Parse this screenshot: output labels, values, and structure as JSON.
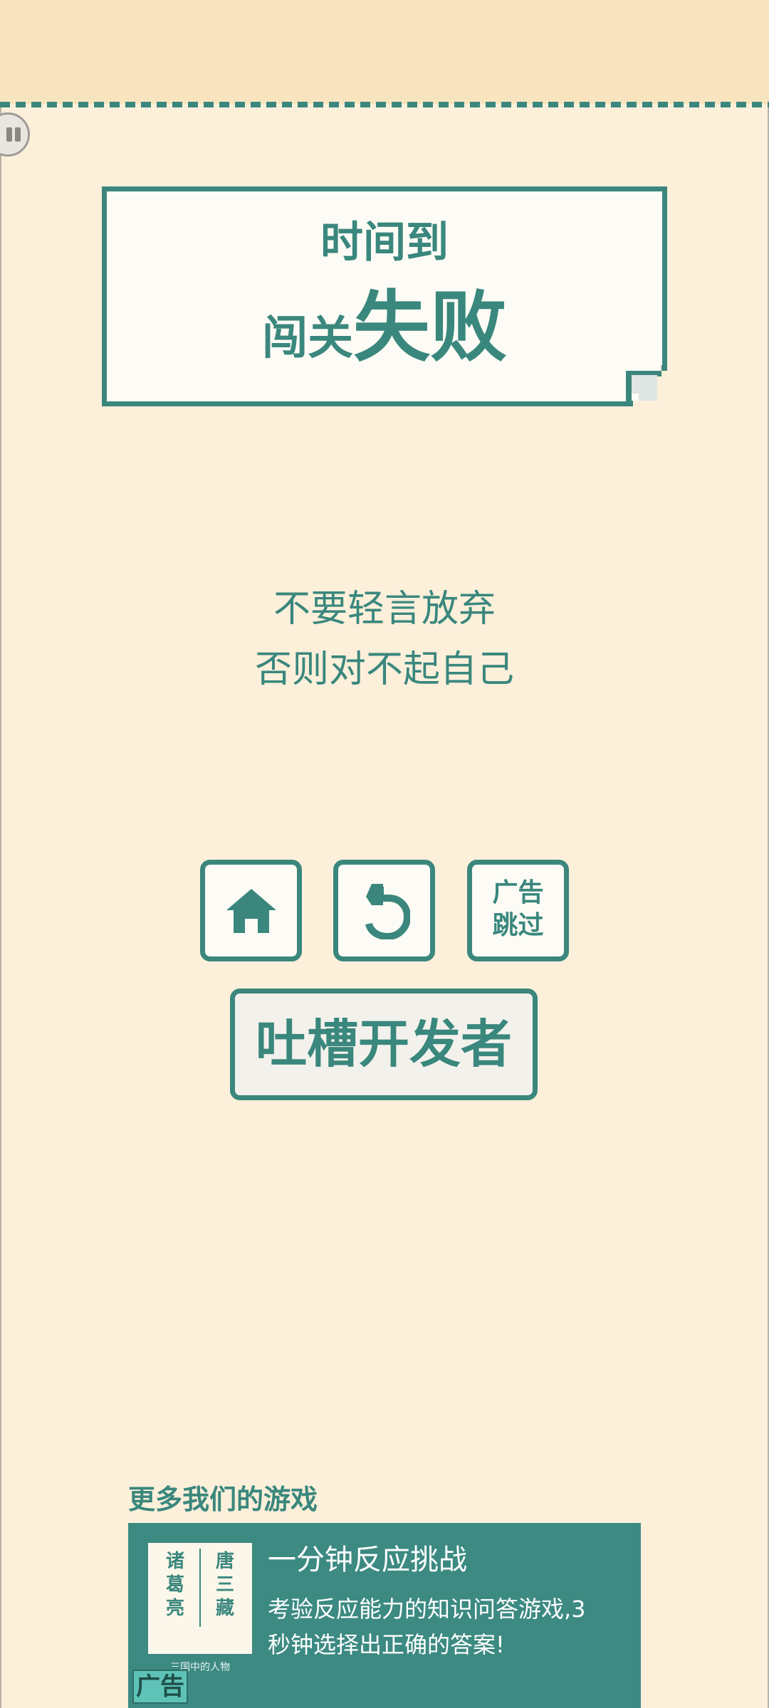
{
  "result": {
    "line1": "时间到",
    "line2_prefix": "闯关",
    "line2_emphasis": "失败"
  },
  "motto": {
    "line1": "不要轻言放弃",
    "line2": "否则对不起自己"
  },
  "buttons": {
    "home_icon": "home-icon",
    "restart_icon": "restart-icon",
    "skip_label": "广告\n跳过",
    "feedback_label": "吐槽开发者"
  },
  "more_games": {
    "title": "更多我们的游戏",
    "thumb_left": "诸\n葛\n亮",
    "thumb_right": "唐\n三\n藏",
    "thumb_caption": "三国中的人物",
    "game_title": "一分钟反应挑战",
    "game_desc": "考验反应能力的知识问答游戏,3秒钟选择出正确的答案!",
    "ad_badge": "广告"
  },
  "colors": {
    "accent": "#3b877d",
    "background": "#fcf0db",
    "header": "#f8e5c0"
  }
}
